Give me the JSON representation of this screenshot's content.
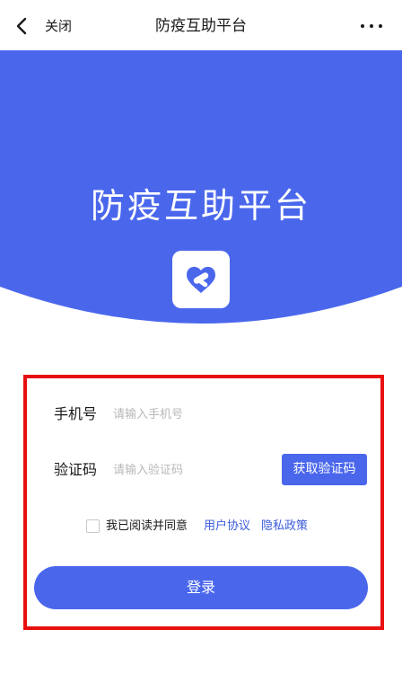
{
  "nav": {
    "close_label": "关闭",
    "title": "防疫互助平台",
    "back_icon": "chevron-left-icon",
    "more_icon": "more-dots-icon"
  },
  "hero": {
    "title": "防疫互助平台",
    "logo_icon": "heart-link-icon",
    "background_color": "#4a67ec"
  },
  "form": {
    "phone_label": "手机号",
    "phone_placeholder": "请输入手机号",
    "phone_value": "",
    "code_label": "验证码",
    "code_placeholder": "请输入验证码",
    "code_value": "",
    "get_code_button": "获取验证码",
    "agree_checked": false,
    "agree_text": "我已阅读并同意",
    "user_agreement_link": "用户协议",
    "privacy_policy_link": "隐私政策",
    "login_button": "登录"
  },
  "colors": {
    "accent": "#4a67ec",
    "link": "#3b5bdb",
    "highlight_frame": "#e81010",
    "placeholder": "#b8b8b8"
  }
}
